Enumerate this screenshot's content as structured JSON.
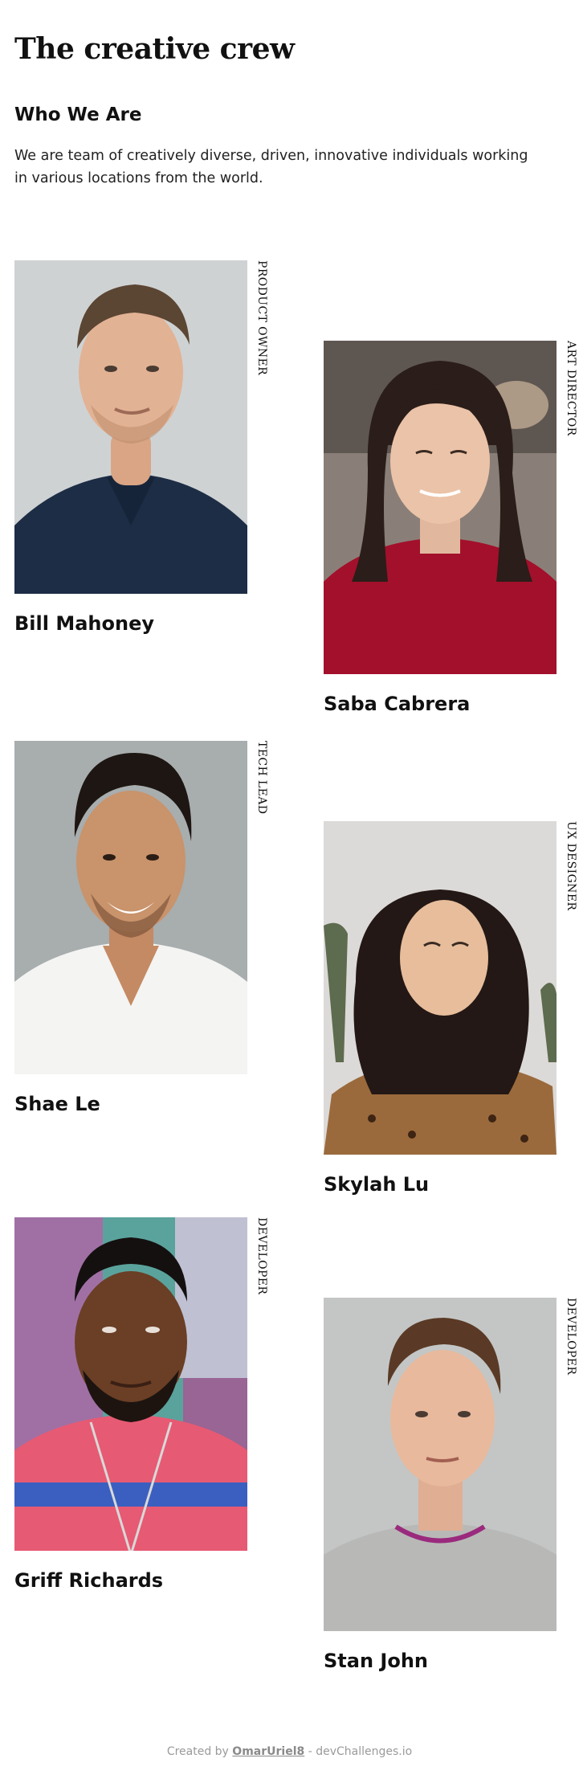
{
  "header": {
    "title": "The creative crew",
    "subtitle": "Who We Are",
    "intro": "We are team of creatively diverse, driven, innovative individuals working in various locations from the world."
  },
  "members": [
    {
      "name": "Bill Mahoney",
      "role": "PRODUCT OWNER"
    },
    {
      "name": "Saba Cabrera",
      "role": "ART DIRECTOR"
    },
    {
      "name": "Shae Le",
      "role": "TECH LEAD"
    },
    {
      "name": "Skylah Lu",
      "role": "UX DESIGNER"
    },
    {
      "name": "Griff Richards",
      "role": "DEVELOPER"
    },
    {
      "name": "Stan John",
      "role": "DEVELOPER"
    }
  ],
  "footer": {
    "prefix": "Created by",
    "author": "OmarUriel8",
    "suffix": "- devChallenges.io"
  }
}
